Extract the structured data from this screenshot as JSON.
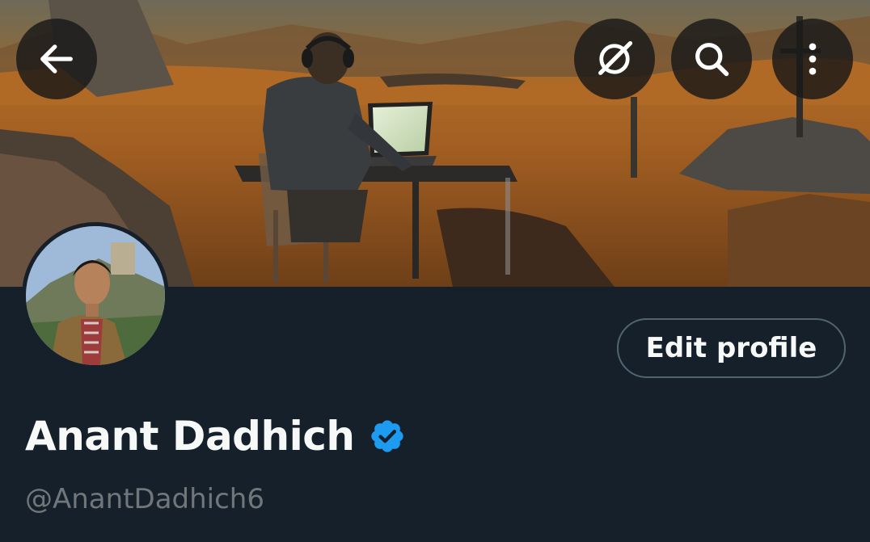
{
  "header": {
    "back_icon": "arrow-left-icon",
    "grok_icon": "grok-icon",
    "search_icon": "search-icon",
    "more_icon": "more-vertical-icon"
  },
  "banner": {
    "description_icon": "banner-image"
  },
  "profile": {
    "display_name": "Anant Dadhich",
    "handle": "@AnantDadhich6",
    "verified": true,
    "edit_button_label": "Edit profile"
  },
  "colors": {
    "background": "#15202b",
    "text_primary": "#f7f9f9",
    "text_secondary": "#71767b",
    "verified_blue": "#1d9bf0",
    "button_border": "#536471"
  }
}
